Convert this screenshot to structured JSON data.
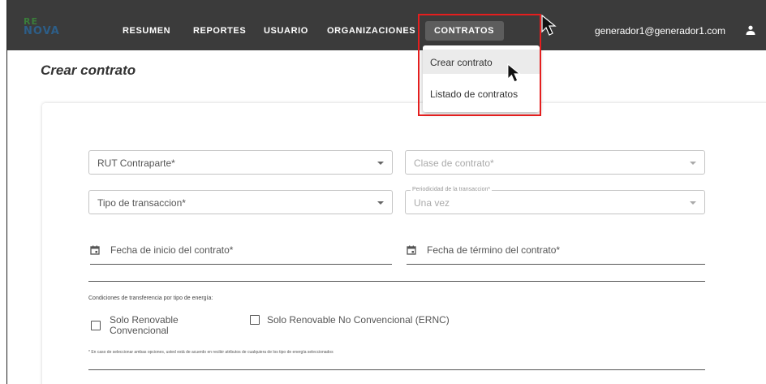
{
  "header": {
    "logo_line1": "RE",
    "logo_line2": "NOVA",
    "nav": [
      {
        "label": "RESUMEN"
      },
      {
        "label": "REPORTES"
      },
      {
        "label": "USUARIO"
      },
      {
        "label": "ORGANIZACIONES"
      },
      {
        "label": "CONTRATOS"
      }
    ],
    "user_email": "generador1@generador1.com",
    "user_icon": "person-icon"
  },
  "dropdown": {
    "items": [
      {
        "label": "Crear contrato"
      },
      {
        "label": "Listado de contratos"
      }
    ]
  },
  "page": {
    "title": "Crear contrato"
  },
  "form": {
    "rut_contraparte": {
      "placeholder": "RUT Contraparte*"
    },
    "clase_contrato": {
      "placeholder": "Clase de contrato*"
    },
    "tipo_transaccion": {
      "placeholder": "Tipo de transaccion*"
    },
    "periodicidad": {
      "legend": "Periodicidad de la transaccion*",
      "value": "Una vez"
    },
    "fecha_inicio": {
      "placeholder": "Fecha de inicio del contrato*"
    },
    "fecha_termino": {
      "placeholder": "Fecha de término del contrato*"
    },
    "condiciones_label": "Condiciones de transferencia por tipo de energía:",
    "checkbox_1": {
      "label_line1": "Solo Renovable",
      "label_line2": "Convencional",
      "checked": false
    },
    "checkbox_2": {
      "label": "Solo Renovable No Convencional (ERNC)",
      "checked": false
    },
    "note": "* En caso de seleccionar ambas opciones, usted está de acuerdo en recibir atributos de cualquiera de los tipo de energía seleccionados"
  },
  "colors": {
    "topbar": "#3b3b3b",
    "active_tab": "#5d5d5d",
    "highlight": "#e41e1e"
  }
}
